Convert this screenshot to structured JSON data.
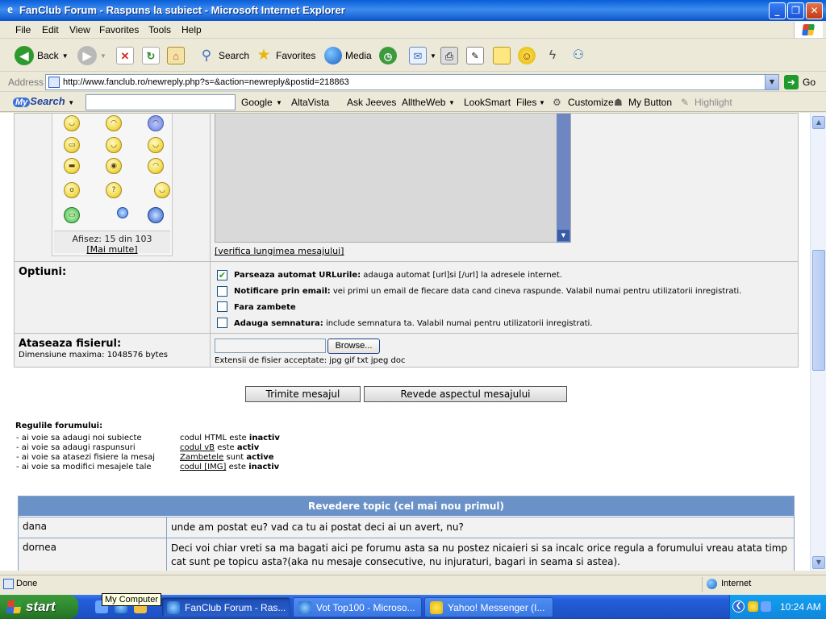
{
  "window": {
    "title": "FanClub Forum - Raspuns la subiect - Microsoft Internet Explorer",
    "minimize_glyph": "_",
    "maximize_glyph": "❐",
    "close_glyph": "✕"
  },
  "menu": [
    "File",
    "Edit",
    "View",
    "Favorites",
    "Tools",
    "Help"
  ],
  "toolbar": {
    "back": "Back",
    "search": "Search",
    "favorites": "Favorites",
    "media": "Media"
  },
  "address": {
    "label": "Address",
    "url": "http://www.fanclub.ro/newreply.php?s=&action=newreply&postid=218863",
    "go": "Go"
  },
  "searchbar": {
    "brand_my": "My",
    "brand_rest": "Search",
    "engines": [
      "Google",
      "AltaVista",
      "Ask Jeeves",
      "AlltheWeb",
      "LookSmart",
      "Files",
      "Customize",
      "My Button",
      "Highlight"
    ]
  },
  "smilies": {
    "shown": "Afisez: 15 din 103",
    "more": "[Mai multe]"
  },
  "message": {
    "check_length": "[verifica lungimea mesajului]"
  },
  "options": {
    "heading": "Optiuni:",
    "items": [
      {
        "bold": "Parseaza automat URLurile:",
        "text": " adauga automat [url]si [/url] la adresele internet.",
        "checked": true
      },
      {
        "bold": "Notificare prin email:",
        "text": " vei primi un email de fiecare data cand cineva raspunde. Valabil numai pentru utilizatorii inregistrati.",
        "checked": false
      },
      {
        "bold": "Fara zambete",
        "text": "",
        "checked": false
      },
      {
        "bold": "Adauga semnatura:",
        "text": " include semnatura ta. Valabil numai pentru utilizatorii inregistrati.",
        "checked": false
      }
    ]
  },
  "attachment": {
    "heading": "Ataseaza fisierul:",
    "max_size": "Dimensiune maxima: 1048576 bytes",
    "browse": "Browse...",
    "extensions": "Extensii de fisier acceptate: jpg gif txt jpeg doc"
  },
  "buttons": {
    "submit": "Trimite mesajul",
    "preview": "Revede aspectul mesajului"
  },
  "rules": {
    "heading": "Regulile forumului:",
    "left": [
      "- ai voie sa adaugi noi subiecte",
      "- ai voie sa adaugi raspunsuri",
      "- ai voie sa atasezi fisiere la mesaj",
      "- ai voie sa modifici mesajele tale"
    ],
    "right": [
      {
        "pre": "codul HTML este ",
        "link": "",
        "mid": "",
        "state": "inactiv"
      },
      {
        "pre": "",
        "link": "codul vB",
        "mid": " este ",
        "state": "activ"
      },
      {
        "pre": "",
        "link": "Zambetele",
        "mid": " sunt ",
        "state": "active"
      },
      {
        "pre": "",
        "link": "codul [IMG]",
        "mid": " este ",
        "state": "inactiv"
      }
    ]
  },
  "review": {
    "heading": "Revedere topic (cel mai nou primul)",
    "rows": [
      {
        "user": "dana",
        "text": "unde am postat eu? vad ca tu ai postat deci ai un avert, nu?"
      },
      {
        "user": "dornea",
        "text": "Deci voi chiar vreti sa ma bagati aici pe forumu asta sa nu postez nicaieri si sa incalc orice regula a forumului vreau atata timp cat sunt pe topicu asta?(aka nu mesaje consecutive, nu injuraturi, bagari in seama si astea)."
      }
    ]
  },
  "status": {
    "left": "Done",
    "zone": "Internet"
  },
  "taskbar": {
    "start": "start",
    "tooltip": "My Computer",
    "tasks": [
      "FanClub Forum - Ras...",
      "Vot Top100 - Microso...",
      "Yahoo! Messenger (I..."
    ],
    "clock": "10:24 AM"
  },
  "colors": {
    "titlebar": "#0a5fd8",
    "review_header": "#6a92c8",
    "form_background": "#f1f1f1",
    "taskbar": "#245edb",
    "start_button": "#2f8a2f"
  }
}
